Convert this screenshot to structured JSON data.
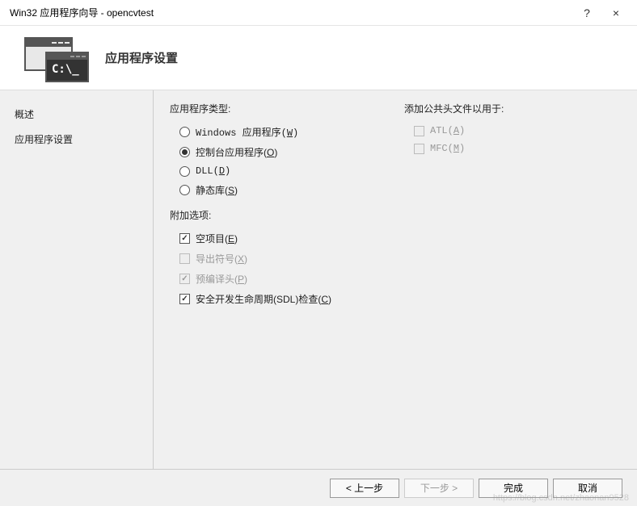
{
  "titlebar": {
    "title": "Win32 应用程序向导 - opencvtest",
    "help": "?",
    "close": "×"
  },
  "header": {
    "title": "应用程序设置",
    "prompt_text": "C:\\_"
  },
  "sidebar": {
    "items": [
      {
        "label": "概述"
      },
      {
        "label": "应用程序设置"
      }
    ]
  },
  "content": {
    "app_type": {
      "label": "应用程序类型:",
      "options": [
        {
          "text": "Windows 应用程序(",
          "accel": "W",
          "suffix": ")",
          "checked": false
        },
        {
          "text": "控制台应用程序(",
          "accel": "O",
          "suffix": ")",
          "checked": true
        },
        {
          "text": "DLL(",
          "accel": "D",
          "suffix": ")",
          "checked": false
        },
        {
          "text": "静态库(",
          "accel": "S",
          "suffix": ")",
          "checked": false
        }
      ]
    },
    "additional": {
      "label": "附加选项:",
      "options": [
        {
          "text": "空项目(",
          "accel": "E",
          "suffix": ")",
          "checked": true,
          "disabled": false
        },
        {
          "text": "导出符号(",
          "accel": "X",
          "suffix": ")",
          "checked": false,
          "disabled": true
        },
        {
          "text": "预编译头(",
          "accel": "P",
          "suffix": ")",
          "checked": true,
          "disabled": true
        },
        {
          "text": "安全开发生命周期(SDL)检查(",
          "accel": "C",
          "suffix": ")",
          "checked": true,
          "disabled": false
        }
      ]
    },
    "headers": {
      "label": "添加公共头文件以用于:",
      "options": [
        {
          "text": "ATL(",
          "accel": "A",
          "suffix": ")",
          "checked": false,
          "disabled": true
        },
        {
          "text": "MFC(",
          "accel": "M",
          "suffix": ")",
          "checked": false,
          "disabled": true
        }
      ]
    }
  },
  "footer": {
    "prev": "< 上一步",
    "next": "下一步 >",
    "finish": "完成",
    "cancel": "取消"
  },
  "watermark": "https://blog.csdn.net/zhaonan9528"
}
